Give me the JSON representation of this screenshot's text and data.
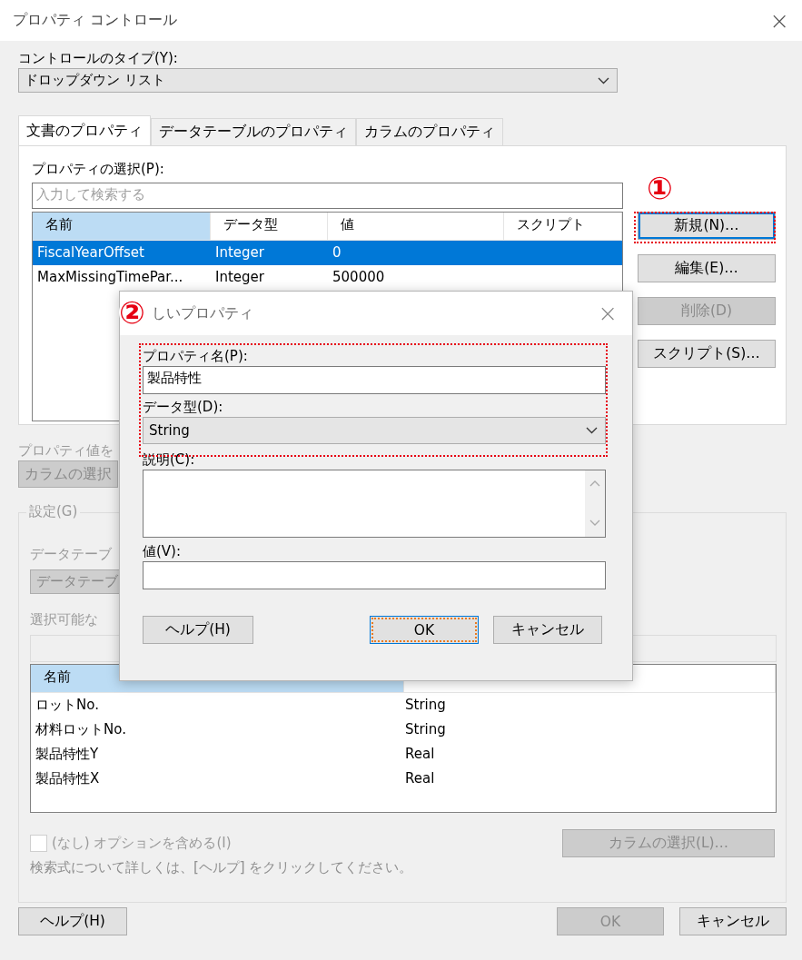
{
  "window": {
    "title": "プロパティ コントロール",
    "close": "×"
  },
  "control_type": {
    "label": "コントロールのタイプ(Y):",
    "value": "ドロップダウン リスト"
  },
  "tabs": [
    {
      "label": "文書のプロパティ",
      "selected": true
    },
    {
      "label": "データテーブルのプロパティ",
      "selected": false
    },
    {
      "label": "カラムのプロパティ",
      "selected": false
    }
  ],
  "property_select": {
    "label": "プロパティの選択(P):",
    "search_placeholder": "入力して検索する",
    "columns": [
      {
        "label": "名前",
        "selected": true
      },
      {
        "label": "データ型",
        "selected": false
      },
      {
        "label": "値",
        "selected": false
      },
      {
        "label": "スクリプト",
        "selected": false
      }
    ],
    "rows": [
      {
        "cells": [
          "FiscalYearOffset",
          "Integer",
          "0",
          ""
        ],
        "selected": true
      },
      {
        "cells": [
          "MaxMissingTimePar...",
          "Integer",
          "500000",
          ""
        ],
        "selected": false
      }
    ]
  },
  "side_buttons": [
    {
      "label": "新規(N)…",
      "disabled": false,
      "highlighted": true
    },
    {
      "label": "編集(E)…",
      "disabled": false,
      "highlighted": false
    },
    {
      "label": "削除(D)",
      "disabled": true,
      "highlighted": false
    },
    {
      "label": "スクリプト(S)…",
      "disabled": false,
      "highlighted": false
    }
  ],
  "property_value": {
    "label": "プロパティ値を",
    "button": "カラムの選択"
  },
  "settings": {
    "legend": "設定(G)",
    "table_label": "データテーブ",
    "table_value": "データテーブ",
    "selectable_label": "選択可能な",
    "columns": [
      {
        "label": "名前",
        "selected": true
      },
      {
        "selected": false
      }
    ],
    "rows": [
      [
        "ロットNo.",
        "String"
      ],
      [
        "材料ロットNo.",
        "String"
      ],
      [
        "製品特性Y",
        "Real"
      ],
      [
        "製品特性X",
        "Real"
      ]
    ],
    "checkbox": {
      "label": "(なし) オプションを含める(I)",
      "checked": false
    },
    "select_button": "カラムの選択(L)…",
    "hint": "検索式について詳しくは、[ヘルプ] をクリックしてください。"
  },
  "footer": [
    {
      "label": "ヘルプ(H)",
      "disabled": false
    },
    {
      "label": "OK",
      "disabled": true
    },
    {
      "label": "キャンセル",
      "disabled": false
    }
  ],
  "dialog": {
    "title": "しいプロパティ",
    "close": "×",
    "name_label": "プロパティ名(P):",
    "name_value": "製品特性",
    "type_label": "データ型(D):",
    "type_value": "String",
    "description_label": "説明(C):",
    "value_label": "値(V):",
    "buttons": [
      {
        "label": "ヘルプ(H)",
        "focused": false
      },
      {
        "label": "OK",
        "focused": true
      },
      {
        "label": "キャンセル",
        "focused": false
      }
    ]
  },
  "annotations": [
    {
      "label": "①"
    },
    {
      "label": "②"
    }
  ]
}
